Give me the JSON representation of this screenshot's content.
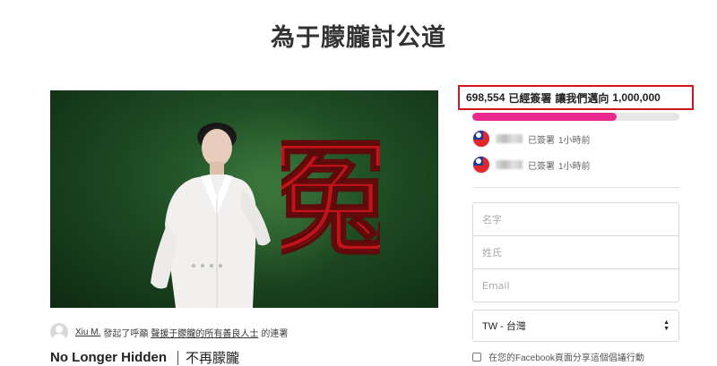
{
  "page": {
    "title": "為于朦朧討公道"
  },
  "hero": {
    "calligraphy_char": "冤"
  },
  "author": {
    "name": "Xiu M.",
    "text_1": "發起了呼籲",
    "target": "聲援于朦朧的所有善良人士",
    "text_2": "的連署"
  },
  "subtitle": {
    "english": "No Longer Hidden",
    "chinese": "不再朦朧"
  },
  "petition": {
    "count": "698,554",
    "signed_label": "已經簽署",
    "goal_text": "讓我們邁向",
    "goal": "1,000,000",
    "progress_fraction": 0.699,
    "accent_color": "#e8288c",
    "highlight_border_color": "#d0161d"
  },
  "signers": [
    {
      "flag_icon": "taiwan-flag-icon",
      "action": "已簽署",
      "time": "1小時前"
    },
    {
      "flag_icon": "taiwan-flag-icon",
      "action": "已簽署",
      "time": "1小時前"
    }
  ],
  "form": {
    "first_name_placeholder": "名字",
    "last_name_placeholder": "姓氏",
    "email_placeholder": "Email",
    "country_selected": "TW - 台灣",
    "share_label": "在您的Facebook頁面分享這個倡議行動"
  }
}
